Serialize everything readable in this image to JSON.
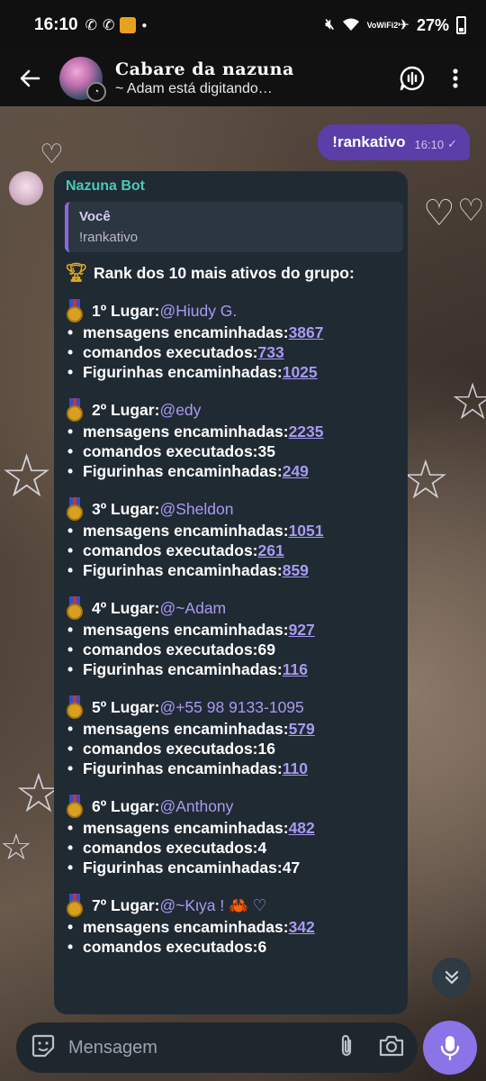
{
  "status_bar": {
    "time": "16:10",
    "battery": "27%",
    "battery_level": 0.27,
    "network_label": "VoWiFi2"
  },
  "header": {
    "title": "Cabare da nazuna",
    "subtitle": "~ Adam está digitando…"
  },
  "outgoing": {
    "text": "!rankativo",
    "time": "16:10"
  },
  "incoming": {
    "sender": "Nazuna Bot",
    "reply": {
      "name": "Você",
      "text": "!rankativo"
    },
    "heading": "Rank dos 10 mais ativos do grupo:",
    "labels": {
      "messages": "mensagens encaminhadas: ",
      "commands": "comandos executados: ",
      "stickers": "Figurinhas encaminhadas: "
    },
    "ranks": [
      {
        "place": "1º Lugar: ",
        "user": "@Hiudy G.",
        "messages": "3867",
        "commands": "733",
        "stickers": "1025"
      },
      {
        "place": "2º Lugar: ",
        "user": "@edy",
        "messages": "2235",
        "commands": "35",
        "stickers": "249"
      },
      {
        "place": "3º Lugar: ",
        "user": "@Sheldon",
        "messages": "1051",
        "commands": "261",
        "stickers": "859"
      },
      {
        "place": "4º Lugar: ",
        "user": "@~Adam",
        "messages": "927",
        "commands": "69",
        "stickers": "116"
      },
      {
        "place": "5º Lugar: ",
        "user": "@+55 98 9133-1095",
        "messages": "579",
        "commands": "16",
        "stickers": "110"
      },
      {
        "place": "6º Lugar: ",
        "user": "@Anthony",
        "messages": "482",
        "commands": "4",
        "stickers": "47"
      },
      {
        "place": "7º Lugar: ",
        "user": "@~Kιya ! 🦀 ♡",
        "messages": "342",
        "commands": "6",
        "stickers": ""
      }
    ]
  },
  "input": {
    "placeholder": "Mensagem"
  },
  "colors": {
    "accent": "#8b73e8",
    "out_bubble": "#5b3ea8",
    "in_bubble": "#202a33",
    "sender": "#4fc6b8",
    "link": "#a89af2"
  }
}
